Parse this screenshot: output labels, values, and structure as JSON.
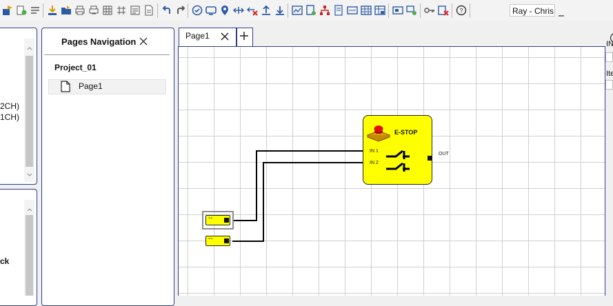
{
  "toolbar": {
    "icons": [
      "import-icon",
      "properties-icon",
      "lines-icon",
      "save-icon",
      "open-folder-icon",
      "print-icon",
      "print-preview-icon",
      "grid-icon",
      "hash-grid-icon",
      "list-icon",
      "document-icon",
      "undo-icon",
      "redo-icon",
      "validate-icon",
      "monitor-icon",
      "location-icon",
      "connect-icon",
      "disconnect-icon",
      "upload-icon",
      "download-icon",
      "chart-icon",
      "report-icon",
      "network-icon",
      "page-icon",
      "screen-icon",
      "table-icon",
      "table-edit-icon",
      "device-icon",
      "route-icon",
      "key-icon",
      "clear-icon"
    ],
    "user": "Ray - Chris"
  },
  "left_panel": {
    "items_top": [
      "2CH)",
      "1CH)"
    ],
    "items_bottom": [
      "ck"
    ]
  },
  "pages_navigation": {
    "title": "Pages Navigation",
    "close_glyph": "✕",
    "project": "Project_01",
    "pages": [
      "Page1"
    ]
  },
  "tabs": {
    "active": "Page1",
    "close_glyph": "✕",
    "add_glyph": "+"
  },
  "diagram": {
    "estop": {
      "title": "E-STOP",
      "inputs": [
        "IN 1",
        "IN 2"
      ],
      "output": "OUT"
    },
    "input_blocks": [
      {
        "label": "--"
      },
      {
        "label": "--"
      }
    ]
  },
  "right_panel": {
    "fragment_1": "IN",
    "fragment_2": "Ite"
  },
  "colors": {
    "accent_border": "#2f3b8e",
    "block_fill": "#ffff00",
    "grid": "#cfcfcf"
  }
}
